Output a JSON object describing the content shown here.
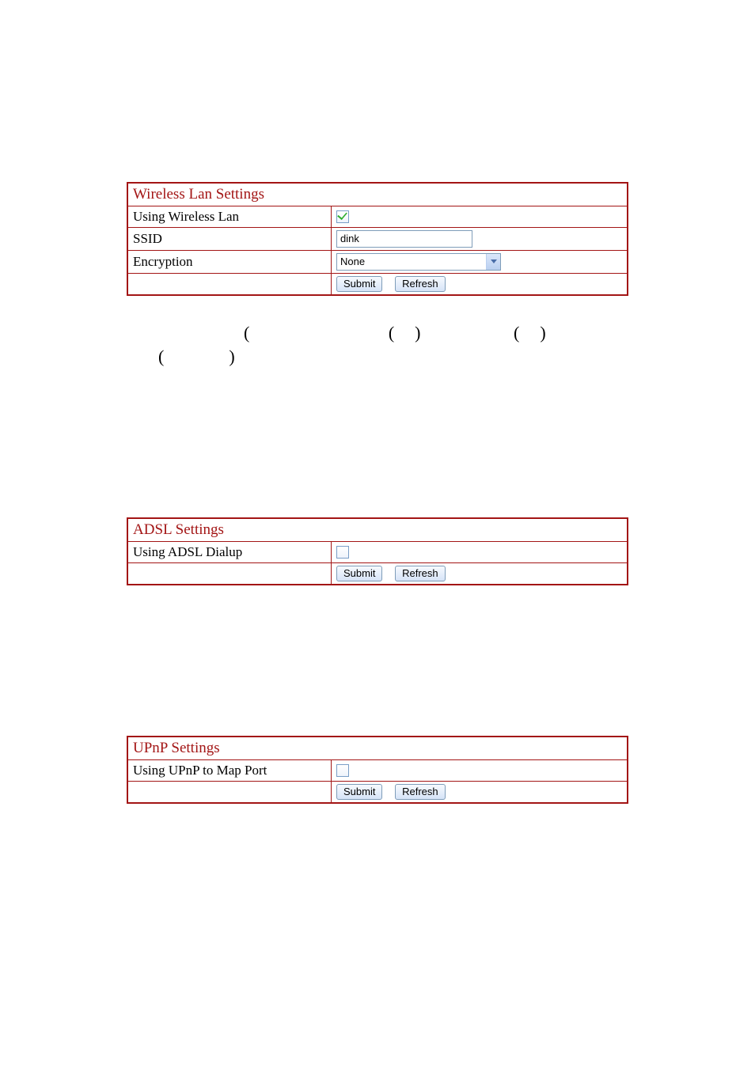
{
  "wireless": {
    "title": "Wireless Lan Settings",
    "using_label": "Using Wireless Lan",
    "using_checked": true,
    "ssid_label": "SSID",
    "ssid_value": "dink",
    "encryption_label": "Encryption",
    "encryption_value": "None",
    "submit": "Submit",
    "refresh": "Refresh"
  },
  "adsl": {
    "title": "ADSL Settings",
    "using_label": "Using ADSL Dialup",
    "using_checked": false,
    "submit": "Submit",
    "refresh": "Refresh"
  },
  "upnp": {
    "title": "UPnP Settings",
    "using_label": "Using UPnP to Map Port",
    "using_checked": false,
    "submit": "Submit",
    "refresh": "Refresh"
  },
  "parens": {
    "g1": "(",
    "g2": "(",
    "g3": ")",
    "g4": "(",
    "g5": ")",
    "g6": "(",
    "g7": ")"
  }
}
